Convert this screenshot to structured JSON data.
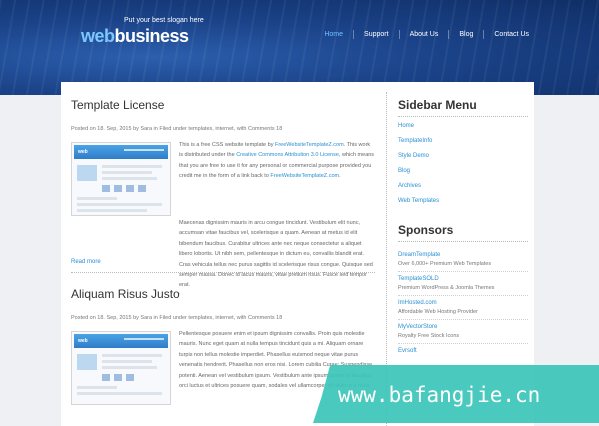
{
  "header": {
    "slogan": "Put your best slogan here",
    "logo_part1": "web",
    "logo_part2": "business",
    "nav": [
      "Home",
      "Support",
      "About Us",
      "Blog",
      "Contact Us"
    ]
  },
  "posts": [
    {
      "title": "Template License",
      "meta": "Posted on 18. Sep, 2015 by Sara in Filed under templates, internet, with Comments 18",
      "p1_a": "This is a free CSS website template by ",
      "p1_link1": "FreeWebsiteTemplateZ.com",
      "p1_b": ". This work is distributed under the ",
      "p1_link2": "Creative Commons Attribution 3.0 License",
      "p1_c": ", which means that you are free to use it for any personal or commercial purpose provided you credit me in the form of a link back to ",
      "p1_link3": "FreeWebsiteTemplateZ.com",
      "p1_d": ".",
      "p2": "Maecenas dignissim mauris in arcu congue tincidunt. Vestibulum elit nunc, accumsan vitae faucibus vel, scelerisque a quam. Aenean at metus id elit bibendum faucibus. Curabitur ultrices ante nec neque consectetur a aliquet libero lobortis. Ut nibh sem, pellentesque in dictum eu, convallis blandit erat. Cras vehicula tellus nec purus sagittis id scelerisque risus congue. Quisque sed semper massa. Donec id lacus mauris, vitae pretium risus. Fusce sed tempor erat.",
      "read_more": "Read more"
    },
    {
      "title": "Aliquam Risus Justo",
      "meta": "Posted on 18. Sep, 2015 by Sara in Filed under templates, internet, with Comments 18",
      "p1": "Pellentesque posuere enim et ipsum dignissim convallis. Proin quis molestie mauris. Nunc eget quam at nulla tempus tincidunt quis a mi. Aliquam ornare turpis non tellus molestie imperdiet. Phasellus euismod neque vitae purus venenatis hendrerit. Phasellus non eros nisi. Lorem cubilia Curae; Suspendisse potenti. Aenean vel vestibulum ipsum. Vestibulum ante ipsum primis in faucibus orci luctus et ultrices posuere quam, sodales vel ullamcorper id, viverra a risus."
    }
  ],
  "thumb_logo": "web",
  "sidebar": {
    "menu_title": "Sidebar Menu",
    "menu": [
      "Home",
      "TemplateInfo",
      "Style Demo",
      "Blog",
      "Archives",
      "Web Templates"
    ],
    "sponsors_title": "Sponsors",
    "sponsors": [
      {
        "name": "DreamTemplate",
        "desc": "Over 6,000+ Premium Web Templates"
      },
      {
        "name": "TemplateSOLD",
        "desc": "Premium WordPress & Joomla Themes"
      },
      {
        "name": "ImHosted.com",
        "desc": "Affordable Web Hosting Provider"
      },
      {
        "name": "MyVectorStore",
        "desc": "Royalty Free Stock Icons"
      },
      {
        "name": "Evrsoft",
        "desc": ""
      }
    ]
  },
  "watermark": "www.bafangjie.cn"
}
